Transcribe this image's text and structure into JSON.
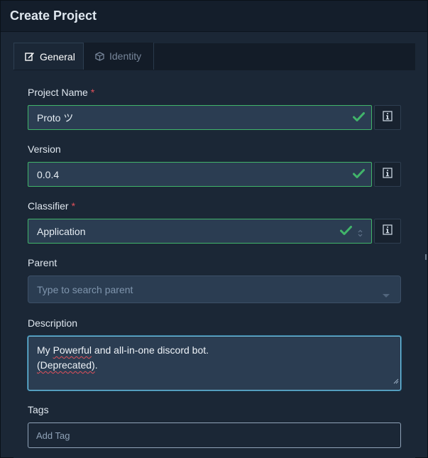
{
  "dialog": {
    "title": "Create Project"
  },
  "tabs": [
    {
      "label": "General",
      "icon": "edit-icon",
      "active": true
    },
    {
      "label": "Identity",
      "icon": "cube-icon",
      "active": false
    }
  ],
  "fields": {
    "project_name": {
      "label": "Project Name",
      "required_mark": "*",
      "value": "Proto ツ",
      "valid": true
    },
    "version": {
      "label": "Version",
      "value": "0.0.4",
      "valid": true
    },
    "classifier": {
      "label": "Classifier",
      "required_mark": "*",
      "value": "Application",
      "valid": true
    },
    "parent": {
      "label": "Parent",
      "placeholder": "Type to search parent"
    },
    "description": {
      "label": "Description",
      "line1_a": "My ",
      "line1_b": "Powerful",
      "line1_c": " and all-in-one discord bot.",
      "line2_a": "(Deprecated)",
      "line2_b": "."
    },
    "tags": {
      "label": "Tags",
      "placeholder": "Add Tag"
    }
  },
  "colors": {
    "valid": "#41b56a",
    "required": "#e0505a",
    "focus": "#74c6e6",
    "background": "#1b2736"
  }
}
